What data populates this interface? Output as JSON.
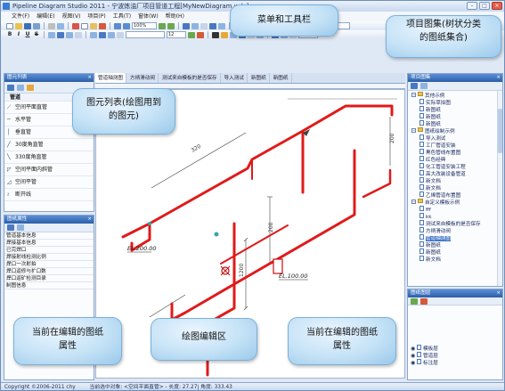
{
  "window": {
    "title": "Pipeline Diagram Studio 2011 - 宁波炼油厂项目管道工程[MyNewDiagram.wds]",
    "minimize": "–",
    "maximize": "□",
    "close": "×"
  },
  "menu": [
    "文件(F)",
    "编辑(E)",
    "视图(V)",
    "项目(P)",
    "工具(T)",
    "窗体(W)",
    "帮助(H)"
  ],
  "toolbar": {
    "zoom": "100%",
    "line_width": "12",
    "layer_select": "管道层",
    "value_field": "0",
    "bold": "B",
    "italic": "I",
    "underline": "U",
    "strike": "S"
  },
  "tabs": [
    "管道轴测图",
    "方柄滑动阀",
    "测试来自模板的是否保存",
    "导入测试",
    "新图纸",
    "新图纸"
  ],
  "left_panel": {
    "title": "图元列表",
    "category": "管道",
    "items": [
      "空间平面直管",
      "水平管",
      "垂直管",
      "30度角直管",
      "330度角直管",
      "空间平面内斜管",
      "空间平管",
      "断开线"
    ]
  },
  "props_panel": {
    "title": "图纸属性",
    "rows": [
      "管道基本信息",
      "焊接基本信息",
      "已完焊口",
      "焊接射线检测比例",
      "焊口一次射拍",
      "焊口返修与扩口数",
      "焊口返矿检测目录",
      "制图信息"
    ]
  },
  "right_panel": {
    "title": "项目图集",
    "tree": [
      {
        "level": 0,
        "type": "folder",
        "label": "其他示例"
      },
      {
        "level": 1,
        "type": "doc",
        "label": "实际草拟图"
      },
      {
        "level": 1,
        "type": "doc",
        "label": "新图纸"
      },
      {
        "level": 1,
        "type": "doc",
        "label": "新图纸"
      },
      {
        "level": 1,
        "type": "doc",
        "label": "新图纸"
      },
      {
        "level": 0,
        "type": "folder",
        "label": "图纸绘制示例"
      },
      {
        "level": 1,
        "type": "doc",
        "label": "导入测试"
      },
      {
        "level": 1,
        "type": "doc",
        "label": "工厂管道安装"
      },
      {
        "level": 1,
        "type": "doc",
        "label": "黑色管线布置图"
      },
      {
        "level": 1,
        "type": "doc",
        "label": "红色经典"
      },
      {
        "level": 1,
        "type": "doc",
        "label": "化工管道安装工程"
      },
      {
        "level": 1,
        "type": "doc",
        "label": "高大改装设备管道"
      },
      {
        "level": 1,
        "type": "doc",
        "label": "新文档"
      },
      {
        "level": 1,
        "type": "doc",
        "label": "新文档"
      },
      {
        "level": 1,
        "type": "doc",
        "label": "乙烯管道布置图"
      },
      {
        "level": 0,
        "type": "folder",
        "label": "自定义模板示例"
      },
      {
        "level": 1,
        "type": "doc",
        "label": "fff"
      },
      {
        "level": 1,
        "type": "doc",
        "label": "kk"
      },
      {
        "level": 1,
        "type": "doc",
        "label": "测试来自模板的是否保存"
      },
      {
        "level": 1,
        "type": "doc",
        "label": "方柄滑动阀"
      },
      {
        "level": 1,
        "type": "doc",
        "label": "管道轴测图",
        "selected": true
      },
      {
        "level": 1,
        "type": "doc",
        "label": "新图纸"
      },
      {
        "level": 1,
        "type": "doc",
        "label": "新图纸"
      },
      {
        "level": 1,
        "type": "doc",
        "label": "新文档"
      }
    ]
  },
  "layers_panel": {
    "title": "图纸图层",
    "layers": [
      "模板层",
      "管道层",
      "标注层"
    ]
  },
  "drawing": {
    "dim_labels": [
      "320",
      "200",
      "1200",
      "200"
    ],
    "elevations": [
      "EL.200.00",
      "EL.100.00"
    ],
    "pipe_color": "#e01a1a"
  },
  "statusbar": {
    "copyright": "Copyright ©2006-2011 chy",
    "info": "当前选中对象: <空间平面直管> - 长度: 27.27| 角度: 333.43"
  },
  "callouts": {
    "menu_toolbar": "菜单和工具栏",
    "project_set_1": "项目图集(树状分类",
    "project_set_2": "的图纸集合)",
    "element_list_1": "图元列表(绘图用到",
    "element_list_2": "的图元)",
    "props_1": "当前在编辑的图纸",
    "props_2": "属性",
    "canvas": "绘图编辑区",
    "layers_1": "当前在编辑的图纸",
    "layers_2": "属性"
  }
}
